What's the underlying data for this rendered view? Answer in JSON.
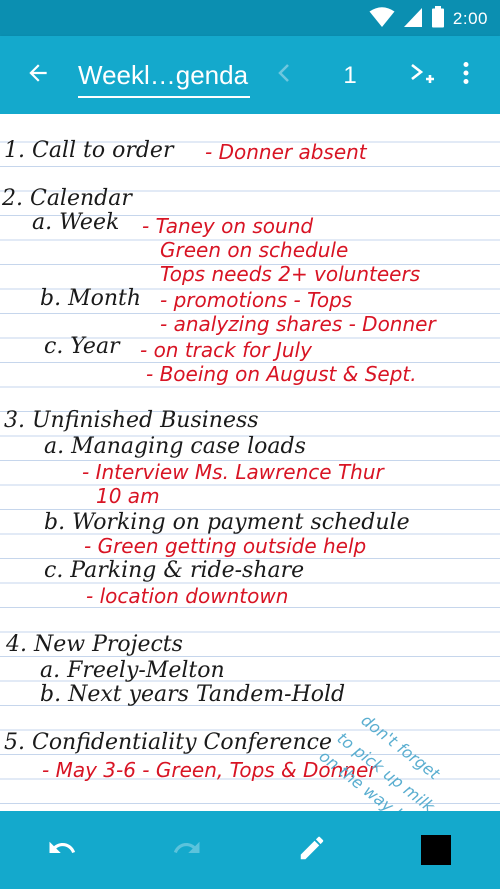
{
  "status_bar": {
    "time": "2:00",
    "icons": [
      "wifi-icon",
      "cell-signal-icon",
      "battery-icon"
    ]
  },
  "app_bar": {
    "back_icon": "arrow-back-icon",
    "title": "Weekl…genda",
    "prev_page_icon": "chevron-left-icon",
    "page_number": "1",
    "add_page_icon": "add-page-icon",
    "more_icon": "more-vertical-icon"
  },
  "note": {
    "lines": [
      {
        "id": "l1",
        "ink": "black",
        "text": "1. Call to order"
      },
      {
        "id": "l1r",
        "ink": "red",
        "text": "- Donner absent"
      },
      {
        "id": "l2",
        "ink": "black",
        "text": "2. Calendar"
      },
      {
        "id": "l2a",
        "ink": "black",
        "text": "a. Week"
      },
      {
        "id": "l2ar1",
        "ink": "red",
        "text": "- Taney on sound"
      },
      {
        "id": "l2ar2",
        "ink": "red",
        "text": "Green on schedule"
      },
      {
        "id": "l2ar3",
        "ink": "red",
        "text": "Tops needs 2+ volunteers"
      },
      {
        "id": "l2b",
        "ink": "black",
        "text": "b. Month"
      },
      {
        "id": "l2br1",
        "ink": "red",
        "text": "- promotions - Tops"
      },
      {
        "id": "l2br2",
        "ink": "red",
        "text": "- analyzing shares - Donner"
      },
      {
        "id": "l2c",
        "ink": "black",
        "text": "c. Year"
      },
      {
        "id": "l2cr1",
        "ink": "red",
        "text": "- on track for July"
      },
      {
        "id": "l2cr2",
        "ink": "red",
        "text": "- Boeing on August & Sept."
      },
      {
        "id": "l3",
        "ink": "black",
        "text": "3. Unfinished Business"
      },
      {
        "id": "l3a",
        "ink": "black",
        "text": "a. Managing case loads"
      },
      {
        "id": "l3ar1",
        "ink": "red",
        "text": "- Interview Ms. Lawrence Thur"
      },
      {
        "id": "l3ar2",
        "ink": "red",
        "text": "10 am"
      },
      {
        "id": "l3b",
        "ink": "black",
        "text": "b. Working on payment schedule"
      },
      {
        "id": "l3br1",
        "ink": "red",
        "text": "- Green getting outside help"
      },
      {
        "id": "l3c",
        "ink": "black",
        "text": "c. Parking & ride-share"
      },
      {
        "id": "l3cr1",
        "ink": "red",
        "text": "- location downtown"
      },
      {
        "id": "l4",
        "ink": "black",
        "text": "4. New Projects"
      },
      {
        "id": "l4a",
        "ink": "black",
        "text": "a. Freely-Melton"
      },
      {
        "id": "l4b",
        "ink": "black",
        "text": "b. Next years Tandem-Hold"
      },
      {
        "id": "l5",
        "ink": "black",
        "text": "5. Confidentiality Conference"
      },
      {
        "id": "l5r",
        "ink": "red",
        "text": "- May 3-6 - Green, Tops & Donner"
      }
    ],
    "side_note": [
      "don't forget",
      "to pick up milk",
      "on the way home!"
    ],
    "ink_colors": {
      "black": "#1a1a1a",
      "red": "#d81424",
      "blue": "#5aaed0"
    },
    "paper_line_color": "#c6d6ec"
  },
  "bottom_bar": {
    "undo_icon": "undo-icon",
    "redo_icon": "redo-icon",
    "pen_icon": "pen-icon",
    "selected_color": "#000000"
  },
  "colors": {
    "status_bar": "#0b8fb1",
    "app_bar": "#14a9cc",
    "accent": "#14a9cc"
  }
}
